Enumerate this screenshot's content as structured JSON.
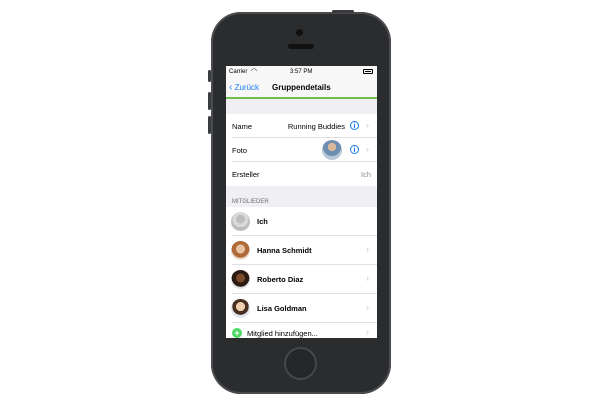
{
  "status": {
    "carrier": "Carrier",
    "time": "3:57 PM"
  },
  "nav": {
    "back_label": "Zurück",
    "title": "Gruppendetails"
  },
  "details": {
    "name_label": "Name",
    "name_value": "Running Buddies",
    "photo_label": "Foto",
    "creator_label": "Ersteller",
    "creator_value": "Ich"
  },
  "members": {
    "section_header": "MITGLIEDER",
    "items": [
      {
        "name": "Ich"
      },
      {
        "name": "Hanna Schmidt"
      },
      {
        "name": "Roberto Diaz"
      },
      {
        "name": "Lisa Goldman"
      }
    ],
    "add_label": "Mitglied hinzufügen..."
  },
  "colors": {
    "accent": "#1a7cf5",
    "nav_line": "#72c04a",
    "add_green": "#4cd964"
  }
}
